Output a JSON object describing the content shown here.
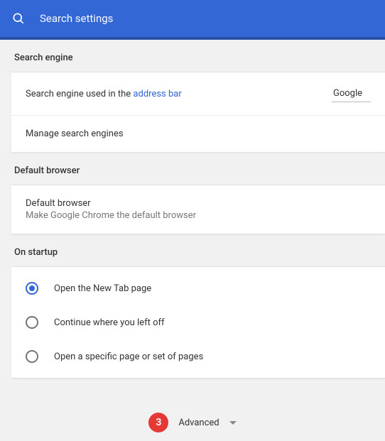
{
  "header": {
    "search_placeholder": "Search settings"
  },
  "sections": {
    "search_engine": {
      "title": "Search engine",
      "row1_prefix": "Search engine used in the ",
      "row1_link": "address bar",
      "row1_value": "Google",
      "row2_label": "Manage search engines"
    },
    "default_browser": {
      "title": "Default browser",
      "row_title": "Default browser",
      "row_sub": "Make Google Chrome the default browser"
    },
    "on_startup": {
      "title": "On startup",
      "options": [
        {
          "label": "Open the New Tab page",
          "checked": true
        },
        {
          "label": "Continue where you left off",
          "checked": false
        },
        {
          "label": "Open a specific page or set of pages",
          "checked": false
        }
      ]
    }
  },
  "advanced": {
    "badge": "3",
    "label": "Advanced"
  }
}
